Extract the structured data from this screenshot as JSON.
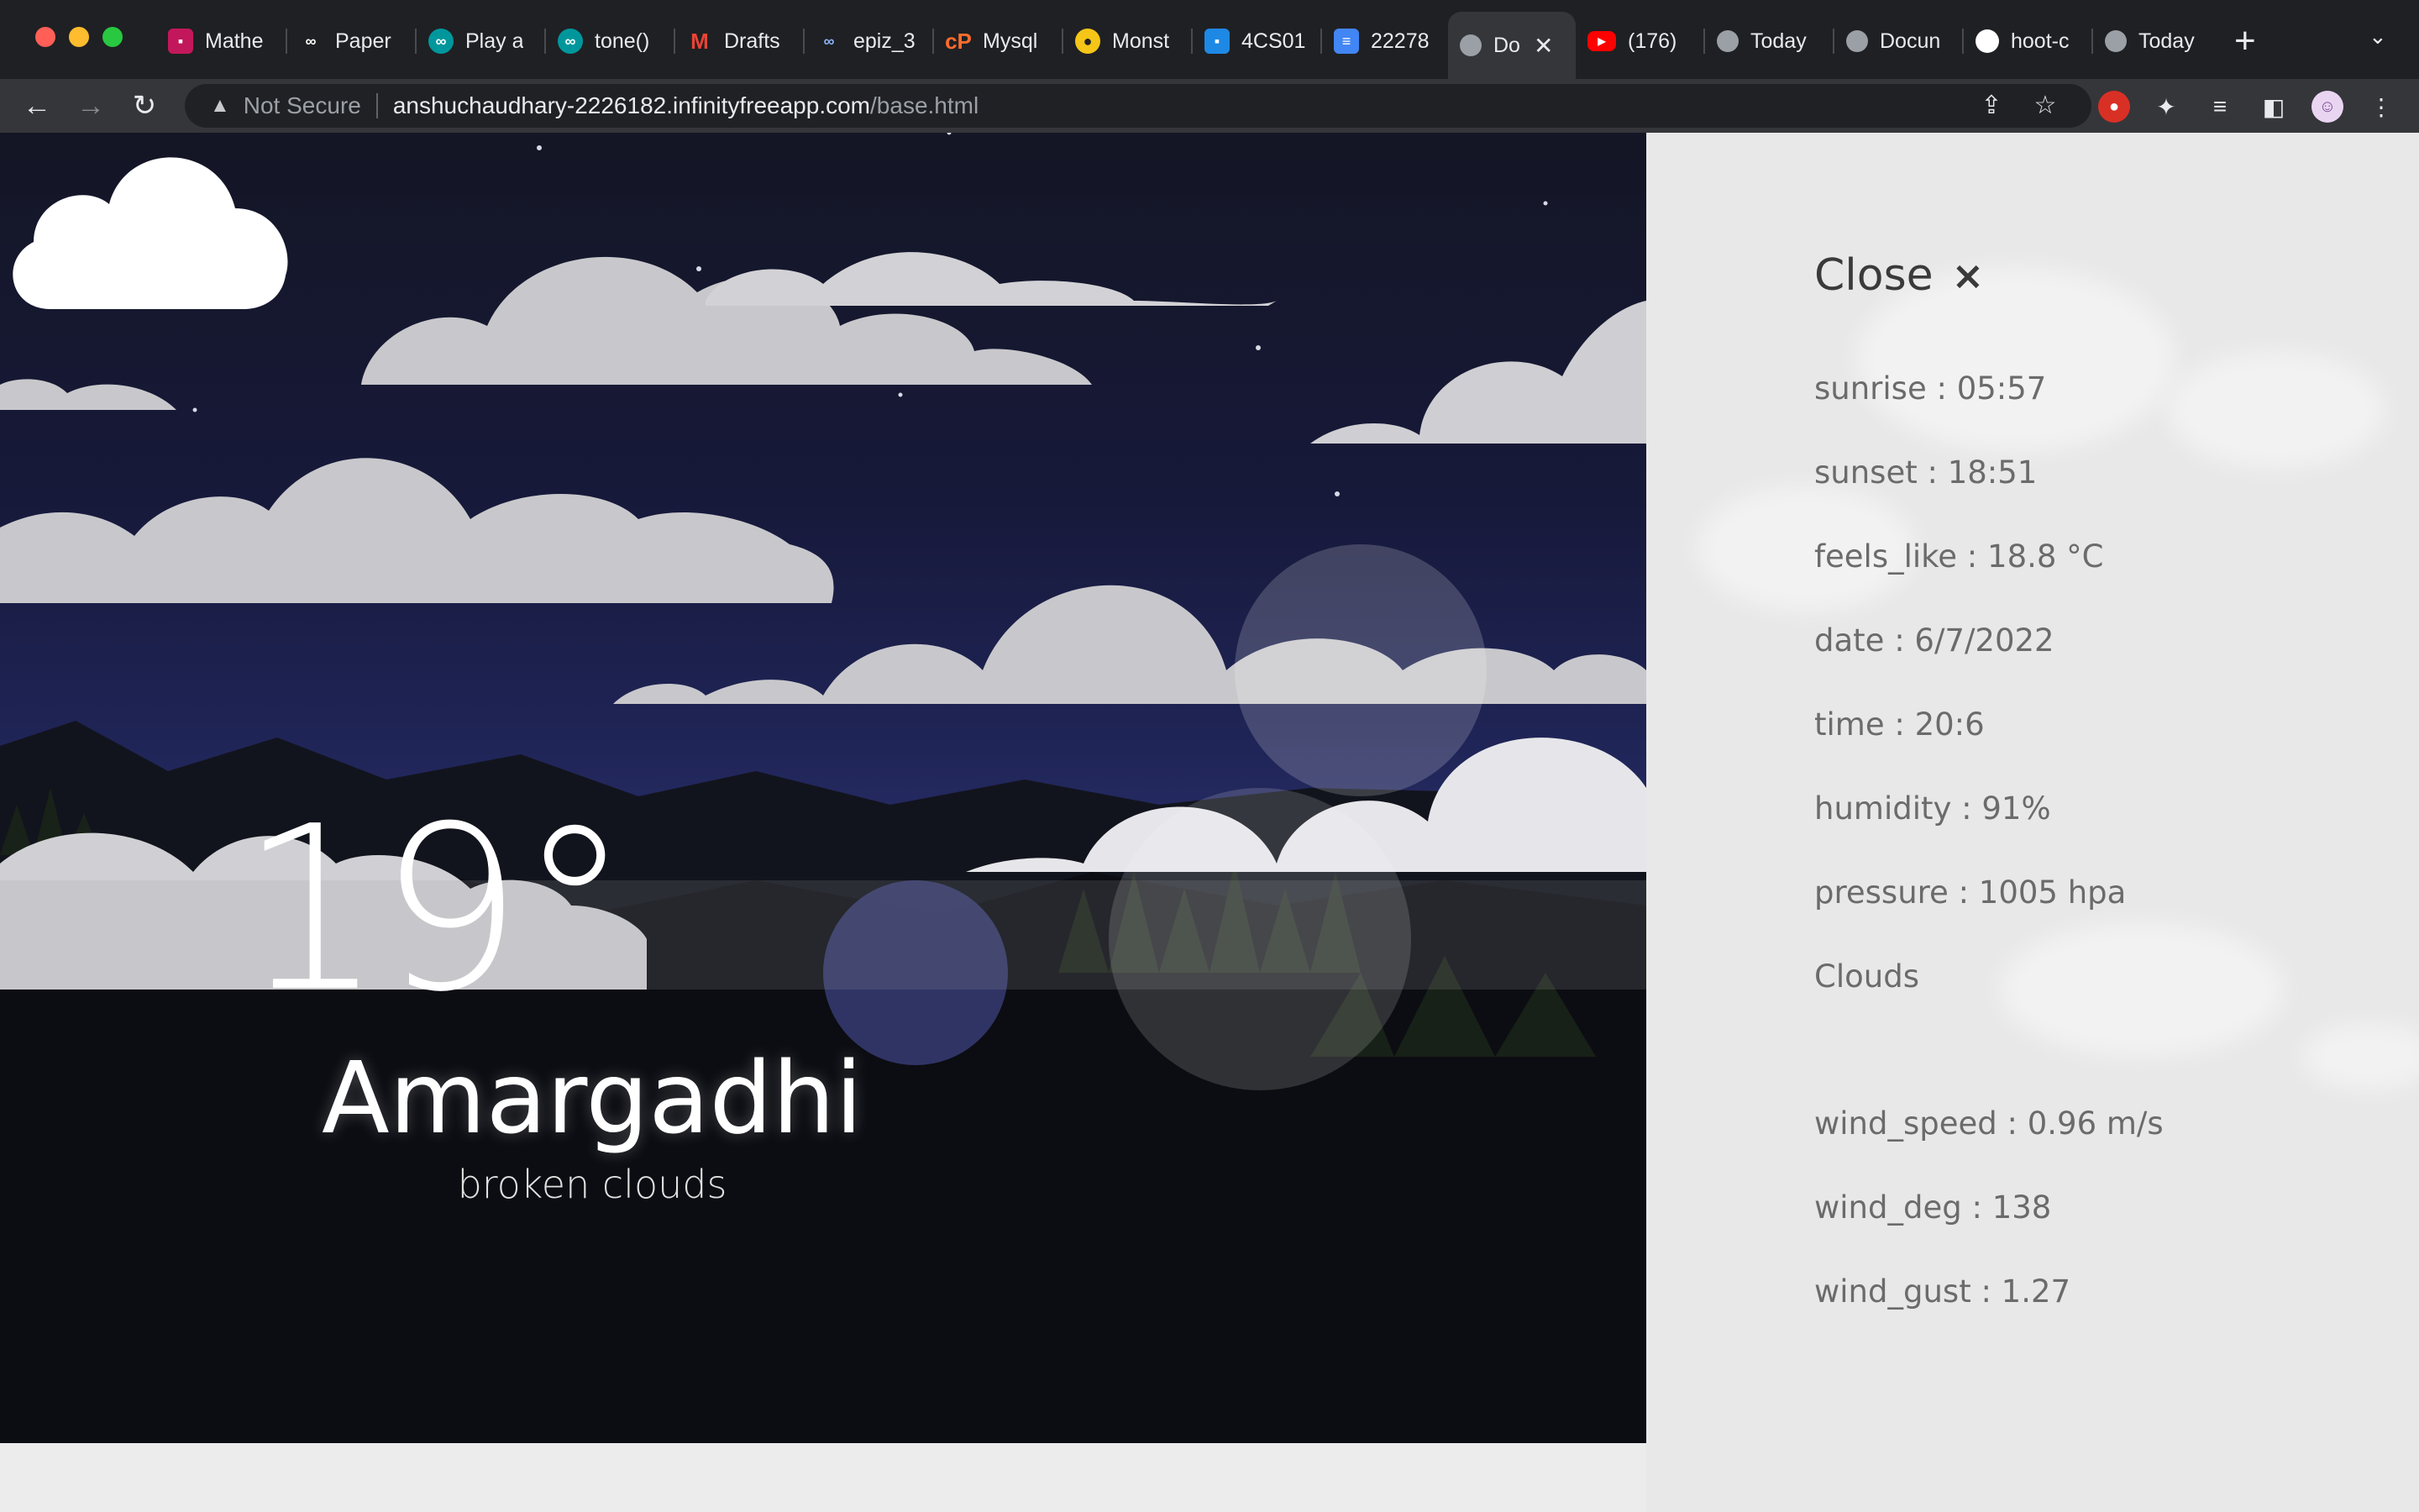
{
  "browser": {
    "tabs": [
      {
        "label": "Mathe",
        "icon": "classroom-icon",
        "color": "#c2185b"
      },
      {
        "label": "Paper",
        "icon": "infinity-icon",
        "color": "#1f2023"
      },
      {
        "label": "Play a",
        "icon": "arduino-icon",
        "color": "#00979c"
      },
      {
        "label": "tone()",
        "icon": "arduino-icon",
        "color": "#00979c"
      },
      {
        "label": "Drafts",
        "icon": "gmail-icon",
        "color": "#ea4335"
      },
      {
        "label": "epiz_3",
        "icon": "infinity-icon",
        "color": "#1f2023"
      },
      {
        "label": "Mysql",
        "icon": "cpanel-icon",
        "color": "#ff6c2c"
      },
      {
        "label": "Monst",
        "icon": "monster-icon",
        "color": "#f5c518"
      },
      {
        "label": "4CS01",
        "icon": "classroom-icon",
        "color": "#1e88e5"
      },
      {
        "label": "22278",
        "icon": "docs-icon",
        "color": "#4285f4"
      },
      {
        "label": "Do",
        "icon": "globe-icon",
        "color": "#9aa0a6"
      },
      {
        "label": "(176)",
        "icon": "youtube-icon",
        "color": "#ff0000"
      },
      {
        "label": "Today",
        "icon": "globe-icon",
        "color": "#9aa0a6"
      },
      {
        "label": "Docun",
        "icon": "globe-icon",
        "color": "#9aa0a6"
      },
      {
        "label": "hoot-c",
        "icon": "github-icon",
        "color": "#ffffff"
      },
      {
        "label": "Today",
        "icon": "globe-icon",
        "color": "#9aa0a6"
      }
    ],
    "address": {
      "security": "Not Secure",
      "host": "anshuchaudhary-2226182.infinityfreeapp.com",
      "path": "/base.html"
    }
  },
  "weather": {
    "temperature": "19°",
    "city": "Amargadhi",
    "description": "broken clouds",
    "condition_icon": "cloud-icon"
  },
  "panel": {
    "close_label": "Close",
    "close_symbol": "×",
    "stats": [
      "sunrise : 05:57",
      "sunset : 18:51",
      "feels_like : 18.8 °C",
      "date : 6/7/2022",
      "time : 20:6",
      "humidity : 91%",
      "pressure : 1005 hpa",
      "Clouds",
      "wind_speed : 0.96 m/s",
      "wind_deg : 138",
      "wind_gust : 1.27"
    ]
  }
}
